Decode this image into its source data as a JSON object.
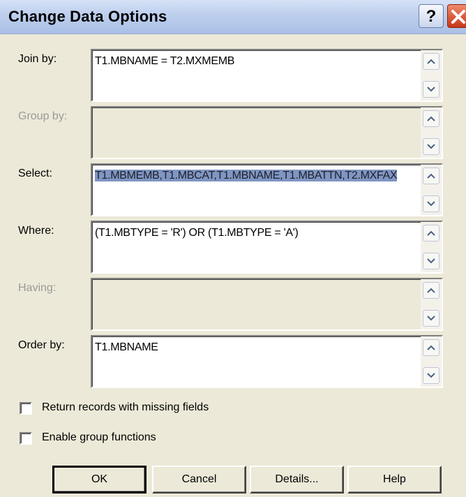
{
  "window": {
    "title": "Change Data Options",
    "help_glyph": "?",
    "close_icon": "close-icon"
  },
  "fields": {
    "join_by": {
      "label": "Join by:",
      "value": "T1.MBNAME = T2.MXMEMB"
    },
    "group_by": {
      "label": "Group by:",
      "value": ""
    },
    "select": {
      "label": "Select:",
      "value": "T1.MBMEMB,T1.MBCAT,T1.MBNAME,T1.MBATTN,T2.MXFAX"
    },
    "where": {
      "label": "Where:",
      "value": "(T1.MBTYPE = 'R') OR (T1.MBTYPE = 'A')"
    },
    "having": {
      "label": "Having:",
      "value": ""
    },
    "order_by": {
      "label": "Order by:",
      "value": "T1.MBNAME"
    }
  },
  "checkboxes": {
    "return_missing": {
      "label": "Return records with missing fields",
      "checked": false
    },
    "enable_group": {
      "label": "Enable group functions",
      "checked": false
    }
  },
  "buttons": {
    "ok": "OK",
    "cancel": "Cancel",
    "details": "Details...",
    "help": "Help"
  },
  "colors": {
    "dialog_bg": "#ece9d8",
    "selection": "#7f96c3",
    "close_red": "#c8371b"
  }
}
